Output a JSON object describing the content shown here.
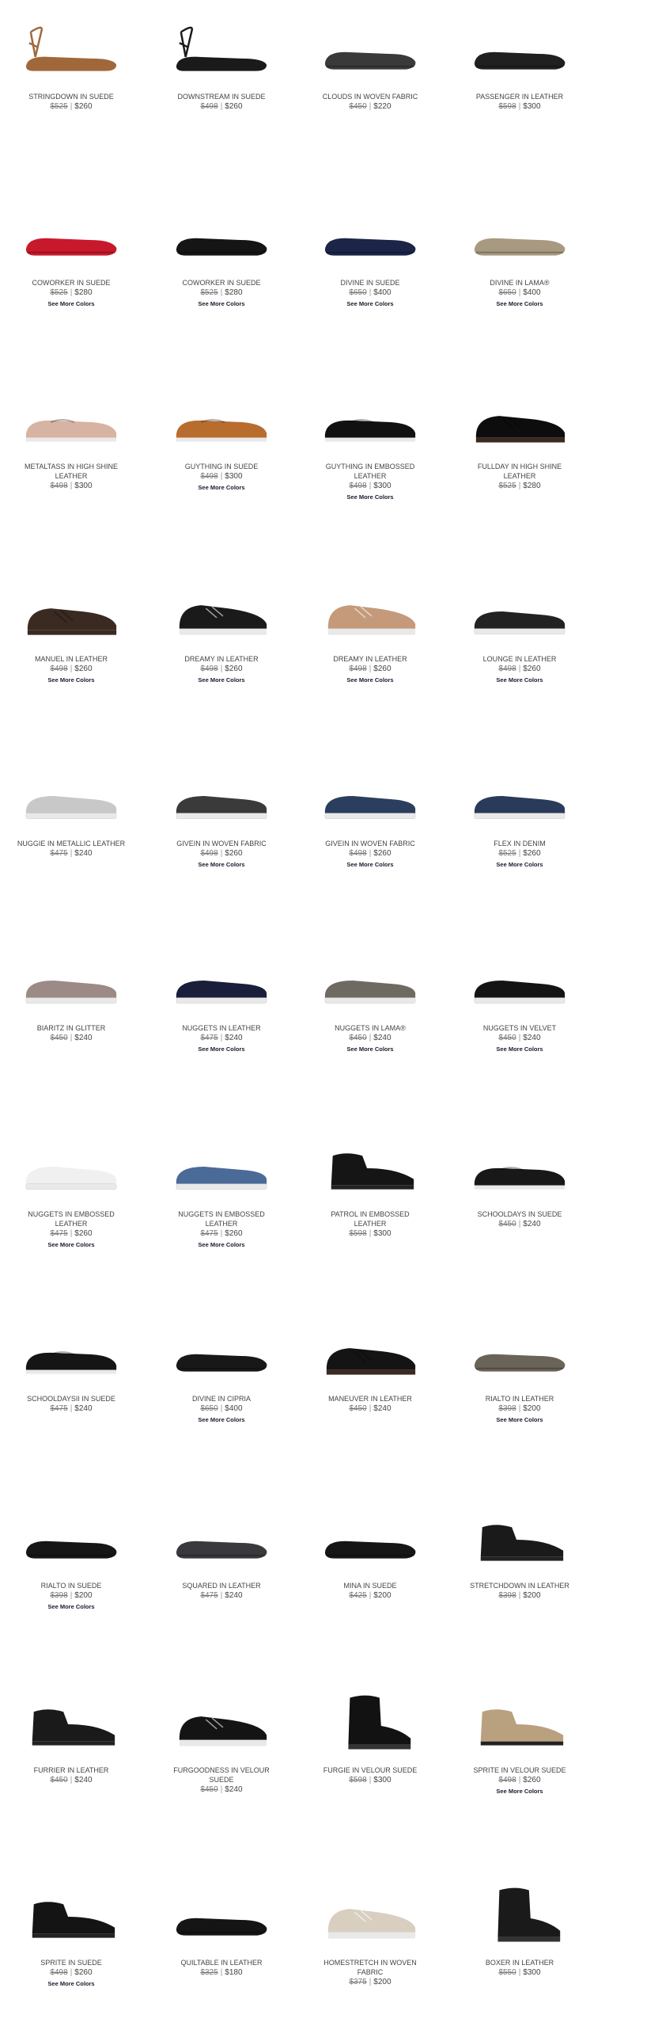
{
  "products": [
    {
      "name": "STRINGDOWN IN SUEDE",
      "old": "$525",
      "new": "$260",
      "more": "",
      "shoe": "strappy",
      "color": "#a0683a"
    },
    {
      "name": "DOWNSTREAM IN SUEDE",
      "old": "$498",
      "new": "$260",
      "more": "",
      "shoe": "strappy",
      "color": "#1a1a1a"
    },
    {
      "name": "CLOUDS IN WOVEN FABRIC",
      "old": "$450",
      "new": "$220",
      "more": "",
      "shoe": "flat",
      "color": "#3a3a3a"
    },
    {
      "name": "PASSENGER IN LEATHER",
      "old": "$598",
      "new": "$300",
      "more": "",
      "shoe": "flat",
      "color": "#202020"
    },
    {
      "name": "COWORKER IN SUEDE",
      "old": "$525",
      "new": "$280",
      "more": "See More Colors",
      "shoe": "flat",
      "color": "#c8192c"
    },
    {
      "name": "COWORKER IN SUEDE",
      "old": "$525",
      "new": "$280",
      "more": "See More Colors",
      "shoe": "flat",
      "color": "#151515"
    },
    {
      "name": "DIVINE IN SUEDE",
      "old": "$650",
      "new": "$400",
      "more": "See More Colors",
      "shoe": "flat",
      "color": "#1c2448"
    },
    {
      "name": "DIVINE IN LAMA®",
      "old": "$650",
      "new": "$400",
      "more": "See More Colors",
      "shoe": "flat",
      "color": "#a89a80"
    },
    {
      "name": "METALTASS IN HIGH SHINE LEATHER",
      "old": "$498",
      "new": "$300",
      "more": "",
      "shoe": "loafer",
      "color": "#d6b3a3"
    },
    {
      "name": "GUYTHING IN SUEDE",
      "old": "$498",
      "new": "$300",
      "more": "See More Colors",
      "shoe": "loafer",
      "color": "#b86c2e"
    },
    {
      "name": "GUYTHING IN EMBOSSED LEATHER",
      "old": "$498",
      "new": "$300",
      "more": "See More Colors",
      "shoe": "loafer",
      "color": "#111111"
    },
    {
      "name": "FULLDAY IN HIGH SHINE LEATHER",
      "old": "$525",
      "new": "$280",
      "more": "",
      "shoe": "oxford",
      "color": "#0d0d0d"
    },
    {
      "name": "MANUEL IN LEATHER",
      "old": "$498",
      "new": "$260",
      "more": "See More Colors",
      "shoe": "oxford",
      "color": "#3b2a22"
    },
    {
      "name": "DREAMY IN LEATHER",
      "old": "$498",
      "new": "$260",
      "more": "See More Colors",
      "shoe": "sneaker",
      "color": "#1a1a1a"
    },
    {
      "name": "DREAMY IN LEATHER",
      "old": "$498",
      "new": "$260",
      "more": "See More Colors",
      "shoe": "sneaker",
      "color": "#c49a7a"
    },
    {
      "name": "LOUNGE IN LEATHER",
      "old": "$498",
      "new": "$260",
      "more": "See More Colors",
      "shoe": "slipon",
      "color": "#222222"
    },
    {
      "name": "NUGGIE IN METALLIC LEATHER",
      "old": "$475",
      "new": "$240",
      "more": "",
      "shoe": "slipon",
      "color": "#c8c8c8"
    },
    {
      "name": "GIVEIN IN WOVEN FABRIC",
      "old": "$498",
      "new": "$260",
      "more": "See More Colors",
      "shoe": "slipon",
      "color": "#3a3a3a"
    },
    {
      "name": "GIVEIN IN WOVEN FABRIC",
      "old": "$498",
      "new": "$260",
      "more": "See More Colors",
      "shoe": "slipon",
      "color": "#2b3e5e"
    },
    {
      "name": "FLEX IN DENIM",
      "old": "$525",
      "new": "$260",
      "more": "See More Colors",
      "shoe": "slipon",
      "color": "#2a3a5a"
    },
    {
      "name": "BIARITZ IN GLITTER",
      "old": "$450",
      "new": "$240",
      "more": "",
      "shoe": "slipon",
      "color": "#9c8a86"
    },
    {
      "name": "NUGGETS IN LEATHER",
      "old": "$475",
      "new": "$240",
      "more": "See More Colors",
      "shoe": "slipon",
      "color": "#1a1e3a"
    },
    {
      "name": "NUGGETS IN LAMA®",
      "old": "$450",
      "new": "$240",
      "more": "See More Colors",
      "shoe": "slipon",
      "color": "#6e6a62"
    },
    {
      "name": "NUGGETS IN VELVET",
      "old": "$450",
      "new": "$240",
      "more": "See More Colors",
      "shoe": "slipon",
      "color": "#141414"
    },
    {
      "name": "NUGGETS IN EMBOSSED LEATHER",
      "old": "$475",
      "new": "$260",
      "more": "See More Colors",
      "shoe": "slipon",
      "color": "#f0f0f0"
    },
    {
      "name": "NUGGETS IN EMBOSSED LEATHER",
      "old": "$475",
      "new": "$260",
      "more": "See More Colors",
      "shoe": "slipon",
      "color": "#4a6a98"
    },
    {
      "name": "PATROL IN EMBOSSED LEATHER",
      "old": "$598",
      "new": "$300",
      "more": "",
      "shoe": "bootie",
      "color": "#151515"
    },
    {
      "name": "SCHOOLDAYS IN SUEDE",
      "old": "$450",
      "new": "$240",
      "more": "",
      "shoe": "loafer",
      "color": "#181818"
    },
    {
      "name": "SCHOOLDAYSII IN SUEDE",
      "old": "$475",
      "new": "$240",
      "more": "",
      "shoe": "loafer",
      "color": "#151515"
    },
    {
      "name": "DIVINE IN CIPRIA",
      "old": "$650",
      "new": "$400",
      "more": "See More Colors",
      "shoe": "flat",
      "color": "#181818"
    },
    {
      "name": "MANEUVER IN LEATHER",
      "old": "$450",
      "new": "$240",
      "more": "",
      "shoe": "oxford",
      "color": "#141414"
    },
    {
      "name": "RIALTO IN LEATHER",
      "old": "$398",
      "new": "$200",
      "more": "See More Colors",
      "shoe": "flat",
      "color": "#6a6458"
    },
    {
      "name": "RIALTO IN SUEDE",
      "old": "$398",
      "new": "$200",
      "more": "See More Colors",
      "shoe": "flat",
      "color": "#161616"
    },
    {
      "name": "SQUARED IN LEATHER",
      "old": "$475",
      "new": "$240",
      "more": "",
      "shoe": "flat",
      "color": "#3a3a3e"
    },
    {
      "name": "MINA IN SUEDE",
      "old": "$425",
      "new": "$200",
      "more": "",
      "shoe": "flat",
      "color": "#161616"
    },
    {
      "name": "STRETCHDOWN IN LEATHER",
      "old": "$398",
      "new": "$200",
      "more": "",
      "shoe": "bootie",
      "color": "#1a1a1a"
    },
    {
      "name": "FURRIER IN LEATHER",
      "old": "$450",
      "new": "$240",
      "more": "",
      "shoe": "bootie",
      "color": "#1a1a1a"
    },
    {
      "name": "FURGOODNESS IN VELOUR SUEDE",
      "old": "$450",
      "new": "$240",
      "more": "",
      "shoe": "sneaker",
      "color": "#141414"
    },
    {
      "name": "FURGIE IN VELOUR SUEDE",
      "old": "$598",
      "new": "$300",
      "more": "",
      "shoe": "boot",
      "color": "#121212"
    },
    {
      "name": "SPRITE IN VELOUR SUEDE",
      "old": "$498",
      "new": "$260",
      "more": "See More Colors",
      "shoe": "bootie",
      "color": "#b9a07e"
    },
    {
      "name": "SPRITE IN SUEDE",
      "old": "$498",
      "new": "$260",
      "more": "See More Colors",
      "shoe": "bootie",
      "color": "#141414"
    },
    {
      "name": "QUILTABLE IN LEATHER",
      "old": "$325",
      "new": "$180",
      "more": "",
      "shoe": "flat",
      "color": "#151515"
    },
    {
      "name": "HOMESTRETCH IN WOVEN FABRIC",
      "old": "$375",
      "new": "$200",
      "more": "",
      "shoe": "sneaker",
      "color": "#d8cfc0"
    },
    {
      "name": "BOXER IN LEATHER",
      "old": "$550",
      "new": "$300",
      "more": "",
      "shoe": "boot",
      "color": "#1a1a1a"
    }
  ]
}
